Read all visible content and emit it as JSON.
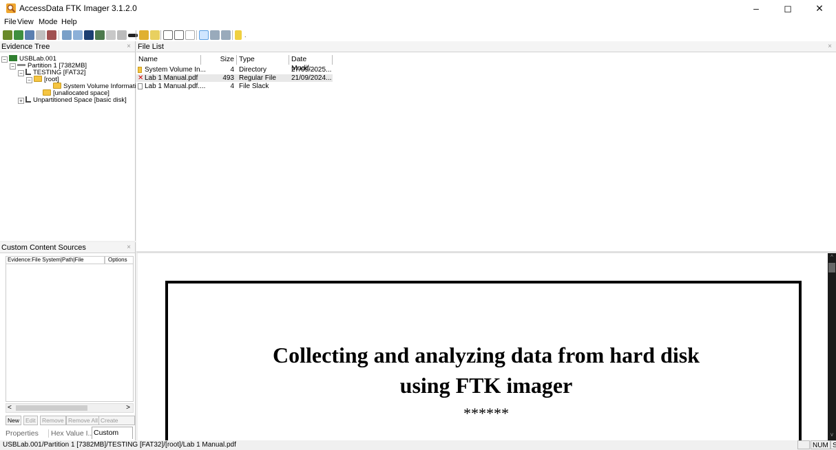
{
  "window": {
    "title": "AccessData FTK Imager 3.1.2.0",
    "controls": {
      "minimize": "–",
      "maximize": "◻",
      "close": "✕"
    }
  },
  "menu": [
    "File",
    "View",
    "Mode",
    "Help"
  ],
  "evidence_tree": {
    "title": "Evidence Tree",
    "close": "×",
    "items": [
      {
        "label": "USBLab.001",
        "expander": "−"
      },
      {
        "label": "Partition 1 [7382MB]",
        "expander": "−"
      },
      {
        "label": "TESTING [FAT32]",
        "expander": "−"
      },
      {
        "label": "[root]",
        "expander": "−"
      },
      {
        "label": "System Volume Information"
      },
      {
        "label": "[unallocated space]"
      },
      {
        "label": "Unpartitioned Space [basic disk]",
        "expander": "+"
      }
    ]
  },
  "file_list": {
    "title": "File List",
    "close": "×",
    "columns": [
      "Name",
      "Size",
      "Type",
      "Date Modif..."
    ],
    "rows": [
      {
        "name": "System Volume In...",
        "size": "4",
        "type": "Directory",
        "date": "27/09/2025...",
        "icon": "folder-icon"
      },
      {
        "name": "Lab 1 Manual.pdf",
        "size": "493",
        "type": "Regular File",
        "date": "21/09/2024...",
        "icon": "deleted-file-icon"
      },
      {
        "name": "Lab 1 Manual.pdf....",
        "size": "4",
        "type": "File Slack",
        "date": "",
        "icon": "file-icon"
      }
    ]
  },
  "viewer": {
    "title_line1": "Collecting and analyzing data from hard disk",
    "title_line2": "using FTK imager",
    "stars": "******"
  },
  "custom_content": {
    "title": "Custom Content Sources",
    "close": "×",
    "columns": [
      "Evidence:File System|Path|File",
      "Options"
    ],
    "buttons": [
      "New",
      "Edit",
      "Remove",
      "Remove All",
      "Create Image"
    ],
    "scroll_left": "<",
    "scroll_right": ">"
  },
  "bottom_tabs": [
    "Properties",
    "Hex Value I...",
    "Custom Co..."
  ],
  "status": {
    "path": "USBLab.001/Partition 1 [7382MB]/TESTING [FAT32]/[root]/Lab 1 Manual.pdf",
    "num": "NUM",
    "scrl": "SCRL"
  },
  "colors": {
    "accent": "#0078d7",
    "folder": "#f5c542",
    "deleted": "#d00000"
  }
}
